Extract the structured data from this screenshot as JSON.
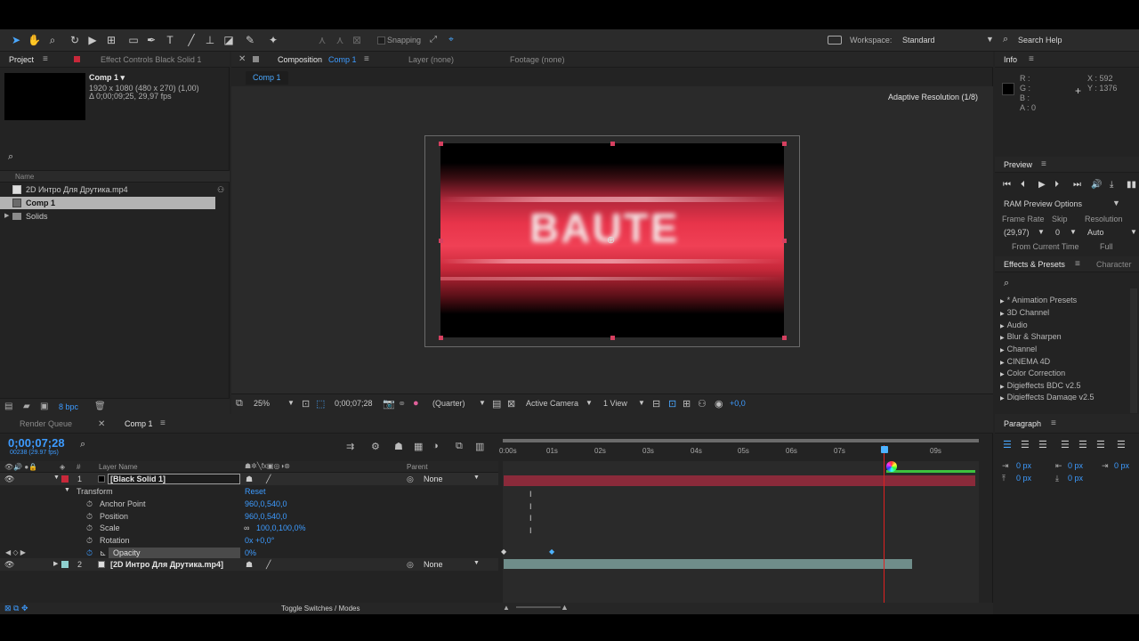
{
  "toolbar": {
    "snapping_label": "Snapping",
    "workspace_label": "Workspace:",
    "workspace_value": "Standard",
    "search_help": "Search Help"
  },
  "project": {
    "tab_project": "Project",
    "tab_effect_controls": "Effect Controls Black Solid 1",
    "comp_name": "Comp 1 ▾",
    "comp_dimensions": "1920 x 1080  (480 x 270) (1,00)",
    "comp_duration": "Δ 0;00;09;25, 29,97 fps",
    "column_name": "Name",
    "items": [
      {
        "label": "2D Интро Для Друтика.mp4",
        "icon": "video-file-icon"
      },
      {
        "label": "Comp 1",
        "icon": "composition-icon"
      },
      {
        "label": "Solids",
        "icon": "folder-icon"
      }
    ],
    "bpc": "8 bpc"
  },
  "viewer": {
    "tab_composition": "Composition",
    "tab_composition_name": "Comp 1",
    "tab_layer": "Layer (none)",
    "tab_footage": "Footage (none)",
    "subtab": "Comp 1",
    "adaptive_resolution": "Adaptive Resolution (1/8)",
    "preview_text": "BAUTE",
    "zoom": "25%",
    "timecode": "0;00;07;28",
    "resolution": "(Quarter)",
    "camera": "Active Camera",
    "views": "1 View",
    "exposure": "+0,0"
  },
  "info": {
    "tab": "Info",
    "r": "R :",
    "g": "G :",
    "b": "B :",
    "a": "A : 0",
    "x": "X : 592",
    "y": "Y : 1376"
  },
  "preview": {
    "tab": "Preview",
    "ram_options": "RAM Preview Options",
    "frame_rate_label": "Frame Rate",
    "skip_label": "Skip",
    "resolution_label": "Resolution",
    "frame_rate_value": "(29,97)",
    "skip_value": "0",
    "resolution_value": "Auto",
    "from_current_time": "From Current Time",
    "full_screen": "Full Screen"
  },
  "effects": {
    "tab_effects": "Effects & Presets",
    "tab_character": "Character",
    "items": [
      "* Animation Presets",
      "3D Channel",
      "Audio",
      "Blur & Sharpen",
      "Channel",
      "CINEMA 4D",
      "Color Correction",
      "Digieffects BDC v2.5",
      "Digieffects Damage v2.5"
    ]
  },
  "timeline": {
    "tab_render_queue": "Render Queue",
    "tab_comp": "Comp 1",
    "current_time": "0;00;07;28",
    "frame_info": "00238 (29.97 fps)",
    "col_layer_name": "Layer Name",
    "col_parent": "Parent",
    "col_number": "#",
    "layer1_number": "1",
    "layer1_name": "[Black Solid 1]",
    "layer1_parent": "None",
    "transform_label": "Transform",
    "transform_reset": "Reset",
    "anchor_label": "Anchor Point",
    "anchor_value": "960,0,540,0",
    "position_label": "Position",
    "position_value": "960,0,540,0",
    "scale_label": "Scale",
    "scale_value": "100,0,100,0%",
    "rotation_label": "Rotation",
    "rotation_value": "0x +0,0°",
    "opacity_label": "Opacity",
    "opacity_value": "0%",
    "layer2_number": "2",
    "layer2_name": "[2D Интро Для Друтика.mp4]",
    "layer2_parent": "None",
    "ruler_ticks": [
      "0:00s",
      "01s",
      "02s",
      "03s",
      "04s",
      "05s",
      "06s",
      "07s",
      "09s"
    ],
    "footer_toggle": "Toggle Switches / Modes"
  },
  "paragraph": {
    "tab": "Paragraph",
    "fields": [
      "0 px",
      "0 px",
      "0 px",
      "0 px",
      "0 px"
    ]
  },
  "colors": {
    "accent_blue": "#3d9bff",
    "cti_red": "#e02020",
    "layer1_label": "#c8283a",
    "layer2_label": "#8fd0cf"
  }
}
